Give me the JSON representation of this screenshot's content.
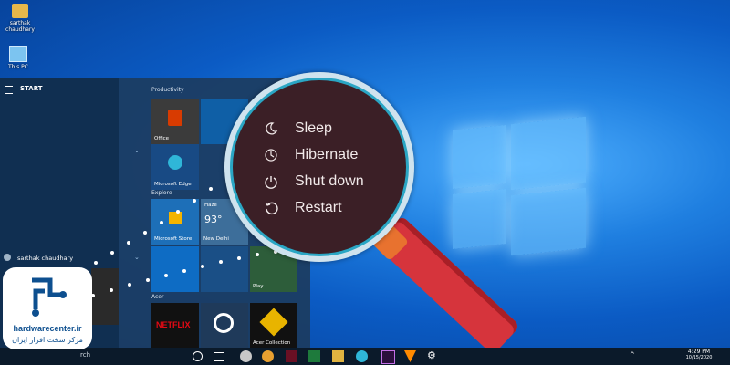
{
  "desktop": {
    "icons": [
      {
        "label": "sarthak chaudhary",
        "icon": "folder-user-icon"
      },
      {
        "label": "This PC",
        "icon": "computer-icon"
      }
    ]
  },
  "start_menu": {
    "header": "START",
    "user": "sarthak chaudhary",
    "groups": {
      "productivity": "Productivity",
      "explore": "Explore",
      "acer": "Acer"
    },
    "tiles": {
      "office": "Office",
      "edge": "Microsoft Edge",
      "store": "Microsoft Store",
      "weather_cond": "Haze",
      "weather_temp": "93°",
      "weather_city": "New Delhi",
      "play": "Play",
      "acer_collection": "Acer Collection",
      "netflix": "NETFLIX"
    },
    "search_text": "rch"
  },
  "power_menu": {
    "items": [
      {
        "label": "Sleep",
        "icon": "moon-icon"
      },
      {
        "label": "Hibernate",
        "icon": "clock-icon"
      },
      {
        "label": "Shut down",
        "icon": "power-icon"
      },
      {
        "label": "Restart",
        "icon": "restart-icon"
      }
    ]
  },
  "taskbar": {
    "time": "4:29 PM",
    "date": "10/15/2020"
  },
  "watermark": {
    "site": "hardwarecenter.ir",
    "persian": "مرکز سخت افزار ایران"
  },
  "colors": {
    "lens_bg": "#3b1f26",
    "lens_ring": "#2aa6c4",
    "handle": "#d6343c",
    "logo_blue": "#0d4f8f"
  }
}
